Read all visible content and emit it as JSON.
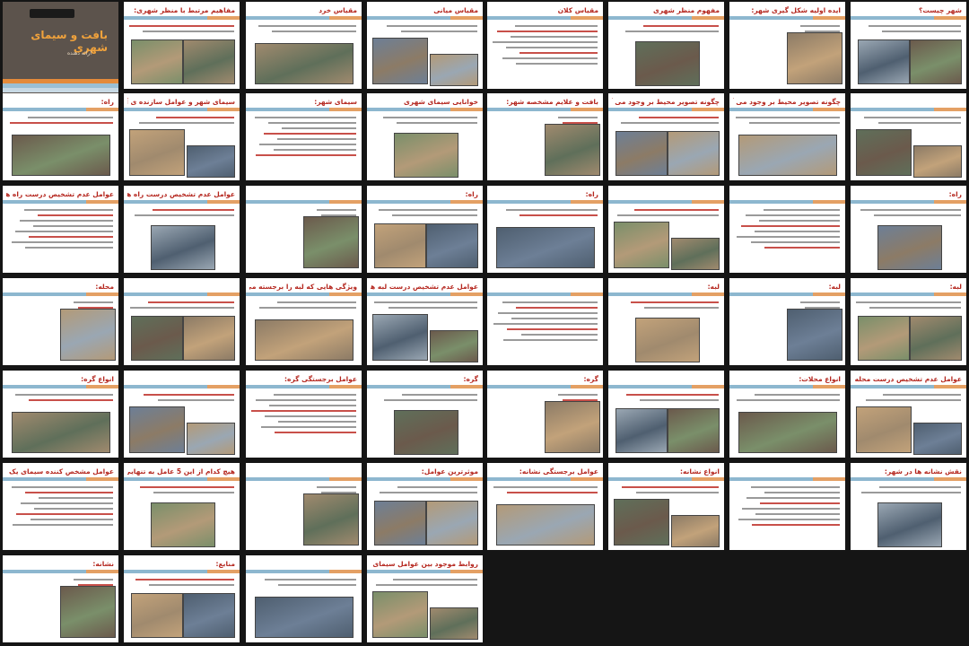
{
  "document": {
    "cover": {
      "title": "بافت و سیمای شهری",
      "subtitle": "ارائه دهنده"
    },
    "slides": [
      {
        "title": "مفاهیم مرتبط با منظر شهری:"
      },
      {
        "title": "مقیاس خرد"
      },
      {
        "title": "مقیاس میانی"
      },
      {
        "title": "مقیاس کلان"
      },
      {
        "title": "مفهوم منظر شهری"
      },
      {
        "title": "ایده اولیه شکل گیری شهر:"
      },
      {
        "title": "شهر چیست؟"
      },
      {
        "title": "راه:"
      },
      {
        "title": "سیمای شهر و عوامل سازنده ی آن:"
      },
      {
        "title": "سیمای شهر:"
      },
      {
        "title": "خوانایی سیمای شهری"
      },
      {
        "title": "بافت و علایم مشخصه شهر:"
      },
      {
        "title": "چگونه تصویر محیط بر وجود می آید:"
      },
      {
        "title": "چگونه تصویر محیط بر وجود می آید:"
      },
      {
        "title": ""
      },
      {
        "title": "عوامل عدم تشخیص درست راه ها:"
      },
      {
        "title": "عوامل عدم تشخیص درست راه ها:"
      },
      {
        "title": ""
      },
      {
        "title": "راه:"
      },
      {
        "title": "راه:"
      },
      {
        "title": ""
      },
      {
        "title": ""
      },
      {
        "title": "راه:"
      },
      {
        "title": "محله:"
      },
      {
        "title": ""
      },
      {
        "title": "ویژگی هایی که لبه را برجسته می سازد:"
      },
      {
        "title": "عوامل عدم تشخیص درست لبه ها:"
      },
      {
        "title": ""
      },
      {
        "title": "لبه:"
      },
      {
        "title": "لبه:"
      },
      {
        "title": "لبه:"
      },
      {
        "title": "انواع گره:"
      },
      {
        "title": ""
      },
      {
        "title": "عوامل برجستگی گره:"
      },
      {
        "title": "گره:"
      },
      {
        "title": "گره:"
      },
      {
        "title": ""
      },
      {
        "title": "انواع محلات:"
      },
      {
        "title": "عوامل عدم تشخیص درست محله:"
      },
      {
        "title": "عوامل مشخص کننده سیمای یک محله: عواملی که"
      },
      {
        "title": "هیچ کدام از این 5 عامل به تنهایی وجود ندارد:"
      },
      {
        "title": ""
      },
      {
        "title": "موثرترین عوامل:"
      },
      {
        "title": "عوامل برجستگی نشانه:"
      },
      {
        "title": "انواع نشانه:"
      },
      {
        "title": ""
      },
      {
        "title": "نقش نشانه ها در شهر:"
      },
      {
        "title": "نشانه:"
      },
      {
        "title": "منابع:"
      },
      {
        "title": ""
      },
      {
        "title": "روابط موجود بین عوامل سیمای شهر:"
      },
      {
        "title": ""
      }
    ]
  },
  "colors": {
    "background": "#151515",
    "title_red": "#b5271f",
    "bar_blue": "#8db7cf",
    "bar_orange": "#e4a064",
    "cover": "#5c534c",
    "cover_title": "#f0a23c"
  }
}
